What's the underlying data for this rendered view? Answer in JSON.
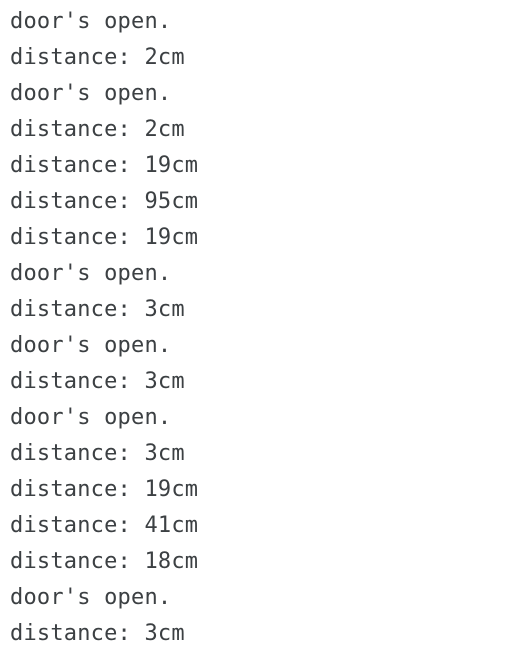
{
  "console": {
    "lines": [
      "door's open.",
      "distance: 2cm",
      "door's open.",
      "distance: 2cm",
      "distance: 19cm",
      "distance: 95cm",
      "distance: 19cm",
      "door's open.",
      "distance: 3cm",
      "door's open.",
      "distance: 3cm",
      "door's open.",
      "distance: 3cm",
      "distance: 19cm",
      "distance: 41cm",
      "distance: 18cm",
      "door's open.",
      "distance: 3cm"
    ]
  },
  "colors": {
    "text": "#3c4043",
    "background": "#ffffff"
  }
}
